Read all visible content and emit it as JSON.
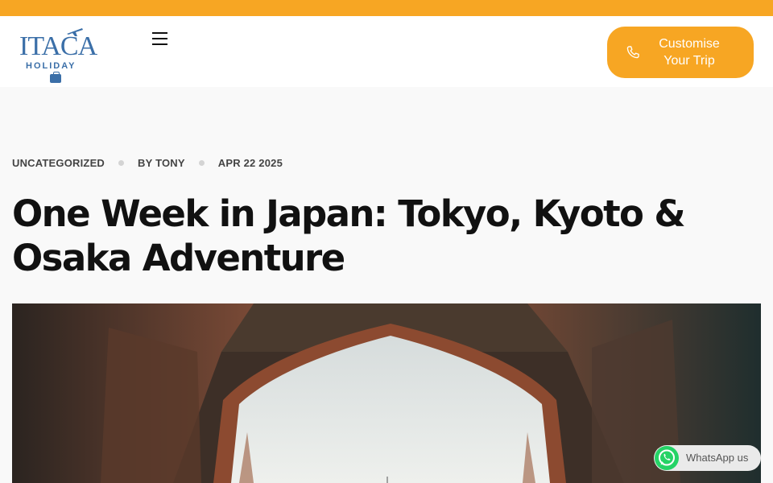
{
  "brand": {
    "logo_text": "ITACA",
    "logo_sub": "HOLIDAY",
    "accent_color": "#f7a623",
    "logo_color": "#3b6fa8"
  },
  "header": {
    "menu_icon": "hamburger-menu-icon",
    "cta_label": "Customise Your Trip",
    "cta_icon": "phone-icon"
  },
  "post": {
    "category": "UNCATEGORIZED",
    "author": "BY TONY",
    "date": "APR 22 2025",
    "title": "One Week in Japan: Tokyo, Kyoto & Osaka Adventure"
  },
  "whatsapp": {
    "label": "WhatsApp us",
    "icon": "whatsapp-icon"
  }
}
